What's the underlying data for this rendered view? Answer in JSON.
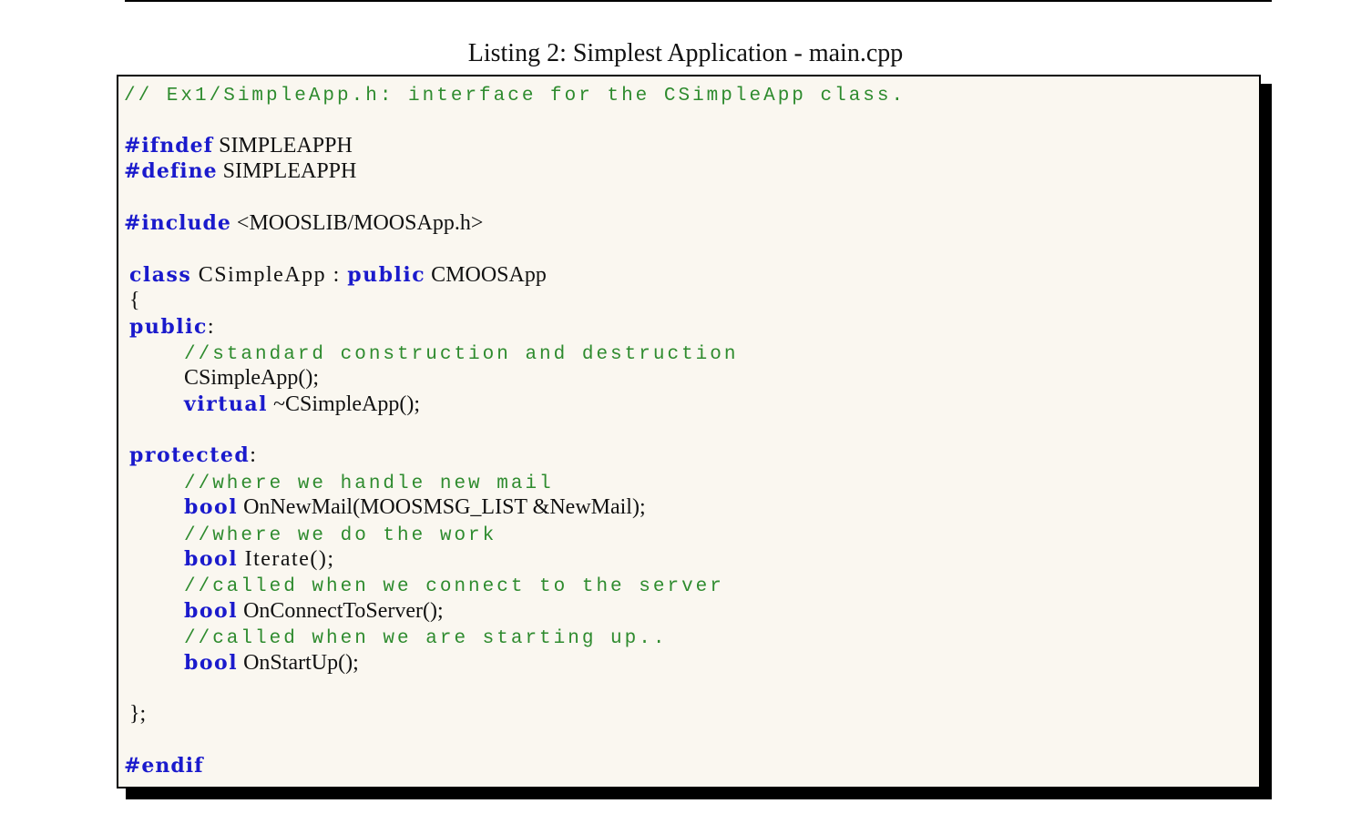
{
  "caption": "Listing 2: Simplest Application - main.cpp",
  "code": {
    "l01_comment": "// Ex1/SimpleApp.h: interface for the CSimpleApp class.",
    "l03_pp": "#ifndef",
    "l03_text": " SIMPLEAPPH",
    "l04_pp": "#define",
    "l04_text": " SIMPLEAPPH",
    "l06_pp": "#include",
    "l06_text": " <MOOSLIB/MOOSApp.h>",
    "l08_kw1": "class",
    "l08_text1": " CSimpleApp : ",
    "l08_kw2": "public",
    "l08_text2": " CMOOSApp",
    "l09_text": "{",
    "l10_kw": "public",
    "l10_text": ":",
    "l11_comment": "//standard construction and destruction",
    "l12_text": "CSimpleApp();",
    "l13_kw": "virtual",
    "l13_text": " ~CSimpleApp();",
    "l15_kw": "protected",
    "l15_text": ":",
    "l16_comment": "//where we handle new mail",
    "l17_kw": "bool",
    "l17_text": " OnNewMail(MOOSMSG_LIST &NewMail);",
    "l18_comment": "//where we do the work",
    "l19_kw": "bool",
    "l19_text": " Iterate();",
    "l20_comment": "//called when we connect to the server",
    "l21_kw": "bool",
    "l21_text": " OnConnectToServer();",
    "l22_comment": "//called when we are starting up..",
    "l23_kw": "bool",
    "l23_text": " OnStartUp();",
    "l25_text": "};",
    "l27_pp": "#endif"
  }
}
